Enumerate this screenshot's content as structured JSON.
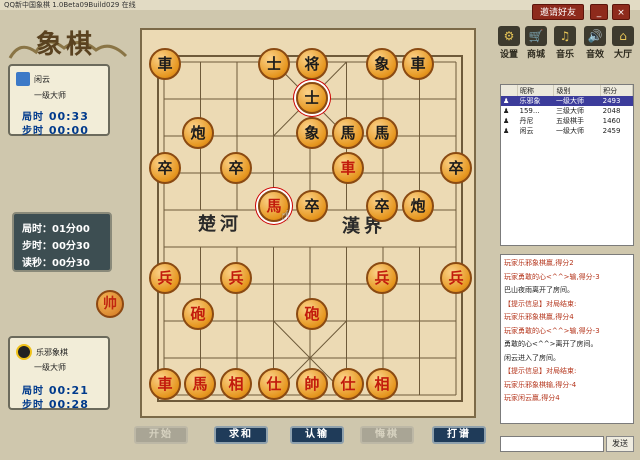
{
  "window": {
    "title": "QQ新中国象棋 1.0Beta09Build029 在线",
    "invite_label": "邀请好友",
    "minimize_label": "_",
    "close_label": "×"
  },
  "logo": "象棋",
  "opponent": {
    "name": "闲云",
    "rank": "一级大师",
    "game_time_label": "局时",
    "game_time": "00:33",
    "step_time_label": "步时",
    "step_time": "00:00"
  },
  "settings": {
    "game_time": "局时：01分00",
    "step_time": "步时：00分30",
    "countdown": "读秒：00分30"
  },
  "turn_piece": "帅",
  "player": {
    "name": "乐邪象棋",
    "rank": "一级大师",
    "game_time_label": "局时",
    "game_time": "00:21",
    "step_time_label": "步时",
    "step_time": "00:28"
  },
  "board": {
    "river_left": "楚河",
    "river_right": "漢界",
    "pieces": [
      {
        "c": "車",
        "side": "black"
      },
      {
        "c": "士",
        "side": "black"
      },
      {
        "c": "将",
        "side": "black"
      },
      {
        "c": "象",
        "side": "black"
      },
      {
        "c": "車",
        "side": "black"
      },
      {
        "c": "士",
        "side": "black"
      },
      {
        "c": "炮",
        "side": "black"
      },
      {
        "c": "象",
        "side": "black"
      },
      {
        "c": "馬",
        "side": "black"
      },
      {
        "c": "馬",
        "side": "black"
      },
      {
        "c": "卒",
        "side": "black"
      },
      {
        "c": "卒",
        "side": "black"
      },
      {
        "c": "車",
        "side": "red"
      },
      {
        "c": "卒",
        "side": "black"
      },
      {
        "c": "馬",
        "side": "red"
      },
      {
        "c": "卒",
        "side": "black"
      },
      {
        "c": "卒",
        "side": "black"
      },
      {
        "c": "炮",
        "side": "black"
      },
      {
        "c": "兵",
        "side": "red"
      },
      {
        "c": "兵",
        "side": "red"
      },
      {
        "c": "兵",
        "side": "red"
      },
      {
        "c": "兵",
        "side": "red"
      },
      {
        "c": "砲",
        "side": "red"
      },
      {
        "c": "砲",
        "side": "red"
      },
      {
        "c": "車",
        "side": "red"
      },
      {
        "c": "馬",
        "side": "red"
      },
      {
        "c": "相",
        "side": "red"
      },
      {
        "c": "仕",
        "side": "red"
      },
      {
        "c": "帥",
        "side": "red"
      },
      {
        "c": "仕",
        "side": "red"
      },
      {
        "c": "相",
        "side": "red"
      }
    ]
  },
  "buttons": {
    "start": "开始",
    "draw": "求和",
    "resign": "认输",
    "undo": "悔棋",
    "spectate": "打谱"
  },
  "tools": [
    {
      "icon": "gear-icon",
      "label": "设置"
    },
    {
      "icon": "cart-icon",
      "label": "商城"
    },
    {
      "icon": "music-icon",
      "label": "音乐"
    },
    {
      "icon": "speaker-icon",
      "label": "音效"
    },
    {
      "icon": "home-icon",
      "label": "大厅"
    }
  ],
  "player_list": {
    "headers": [
      "昵称",
      "级别",
      "积分"
    ],
    "rows": [
      {
        "name": "乐邪象",
        "level": "一级大师",
        "score": "2493"
      },
      {
        "name": "159...",
        "level": "三级大师",
        "score": "2048"
      },
      {
        "name": "丹尼",
        "level": "五级棋手",
        "score": "1460"
      },
      {
        "name": "闲云",
        "level": "一级大师",
        "score": "2459"
      }
    ]
  },
  "chat": [
    {
      "text": "玩家乐邪象棋赢,得分2",
      "color": "red"
    },
    {
      "text": "玩家勇敢的心<^^>输,得分-3",
      "color": "red"
    },
    {
      "text": "巴山夜雨离开了房间。",
      "color": "black"
    },
    {
      "text": "【提示信息】对局结束:",
      "color": "red"
    },
    {
      "text": "玩家乐邪象棋赢,得分4",
      "color": "red"
    },
    {
      "text": "玩家勇敢的心<^^>输,得分-3",
      "color": "red"
    },
    {
      "text": "勇敢的心<^^>离开了房间。",
      "color": "black"
    },
    {
      "text": "闲云进入了房间。",
      "color": "black"
    },
    {
      "text": "【提示信息】对局结束:",
      "color": "red"
    },
    {
      "text": "玩家乐邪象棋输,得分-4",
      "color": "red"
    },
    {
      "text": "玩家闲云赢,得分4",
      "color": "red"
    }
  ],
  "send_label": "发送"
}
